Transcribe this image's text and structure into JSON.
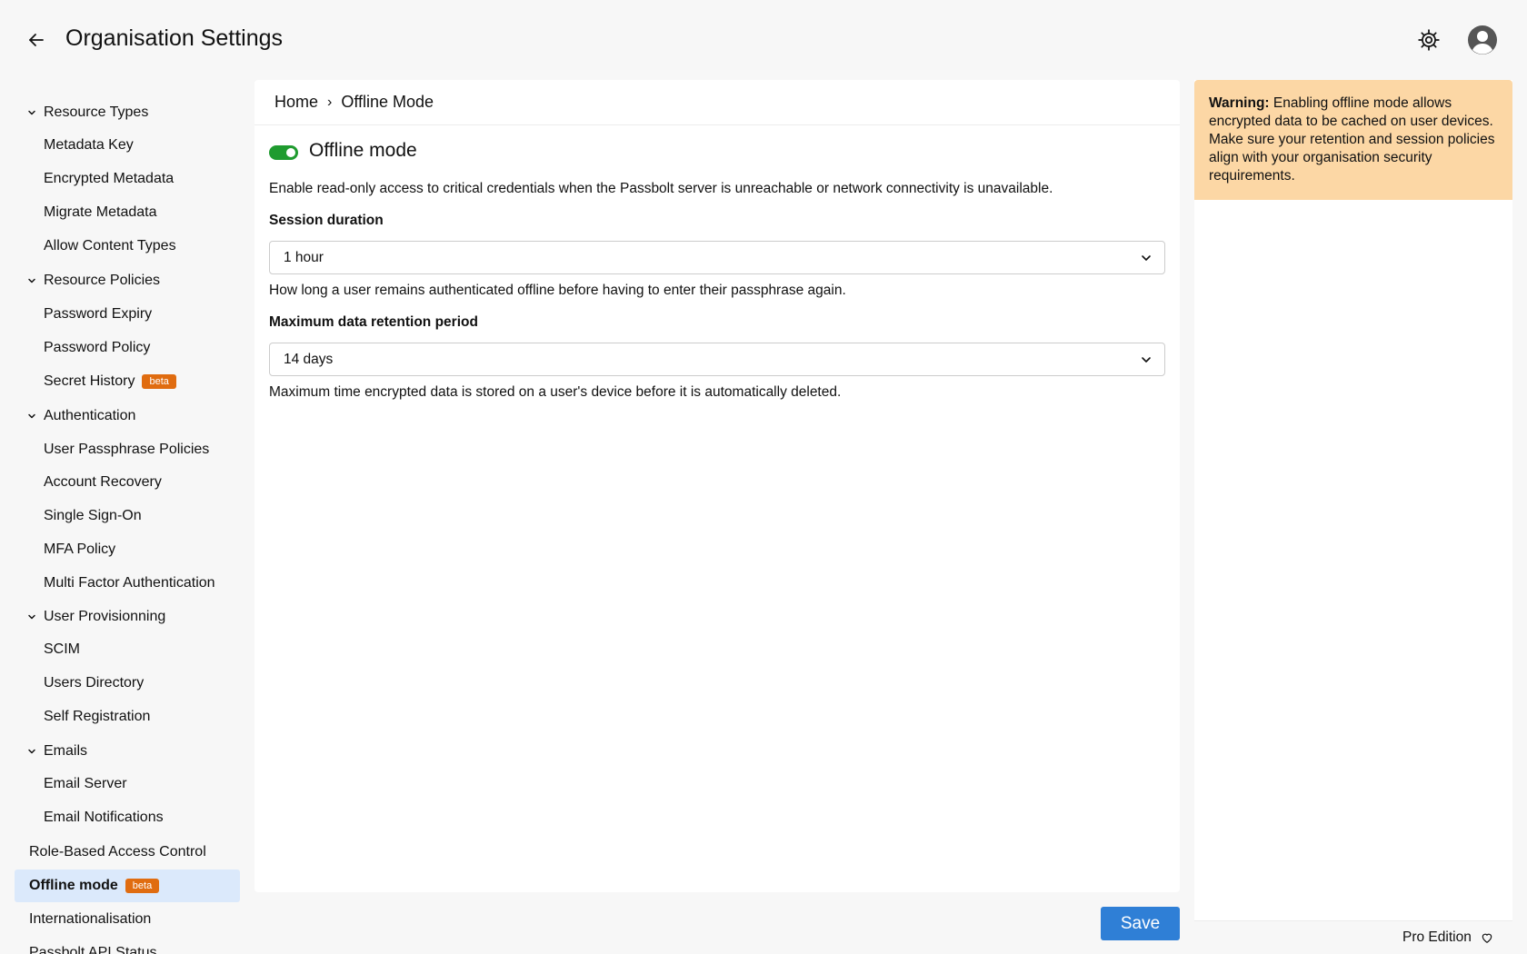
{
  "header": {
    "title": "Organisation Settings",
    "back_icon": "arrow-left-icon",
    "settings_icon": "gear-icon",
    "avatar_icon": "user-avatar-icon"
  },
  "sidebar": {
    "items": [
      {
        "type": "group",
        "label": "Resource Types"
      },
      {
        "type": "child",
        "label": "Metadata Key"
      },
      {
        "type": "child",
        "label": "Encrypted Metadata"
      },
      {
        "type": "child",
        "label": "Migrate Metadata"
      },
      {
        "type": "child",
        "label": "Allow Content Types"
      },
      {
        "type": "group",
        "label": "Resource Policies"
      },
      {
        "type": "child",
        "label": "Password Expiry"
      },
      {
        "type": "child",
        "label": "Password Policy"
      },
      {
        "type": "child",
        "label": "Secret History",
        "badge": "beta"
      },
      {
        "type": "group",
        "label": "Authentication"
      },
      {
        "type": "child",
        "label": "User Passphrase Policies"
      },
      {
        "type": "child",
        "label": "Account Recovery"
      },
      {
        "type": "child",
        "label": "Single Sign-On"
      },
      {
        "type": "child",
        "label": "MFA Policy"
      },
      {
        "type": "child",
        "label": "Multi Factor Authentication"
      },
      {
        "type": "group",
        "label": "User Provisionning"
      },
      {
        "type": "child",
        "label": "SCIM"
      },
      {
        "type": "child",
        "label": "Users Directory"
      },
      {
        "type": "child",
        "label": "Self Registration"
      },
      {
        "type": "group",
        "label": "Emails"
      },
      {
        "type": "child",
        "label": "Email Server"
      },
      {
        "type": "child",
        "label": "Email Notifications"
      },
      {
        "type": "top",
        "label": "Role-Based Access Control"
      },
      {
        "type": "top",
        "label": "Offline mode",
        "badge": "beta",
        "active": true
      },
      {
        "type": "top",
        "label": "Internationalisation"
      },
      {
        "type": "top",
        "label": "Passbolt API Status"
      }
    ]
  },
  "breadcrumb": {
    "home": "Home",
    "separator": "›",
    "current": "Offline Mode"
  },
  "main": {
    "toggle_on": true,
    "section_title": "Offline mode",
    "description": "Enable read-only access to critical credentials when the Passbolt server is unreachable or network connectivity is unavailable.",
    "session": {
      "label": "Session duration",
      "value": "1 hour",
      "help": "How long a user remains authenticated offline before having to enter their passphrase again."
    },
    "retention": {
      "label": "Maximum data retention period",
      "value": "14 days",
      "help": "Maximum time encrypted data is stored on a user's device before it is automatically deleted."
    },
    "save_label": "Save"
  },
  "warning": {
    "title": "Warning:",
    "text": " Enabling offline mode allows encrypted data to be cached on user devices. Make sure your retention and session policies align with your organisation security requirements."
  },
  "footer": {
    "edition": "Pro Edition",
    "heart_icon": "heart-icon"
  },
  "colors": {
    "accent": "#2f7fd6",
    "toggle_on": "#1f9b2f",
    "beta_badge": "#e06c10",
    "warning_bg": "#fcd7a5",
    "active_nav_bg": "#dbe9fb"
  }
}
